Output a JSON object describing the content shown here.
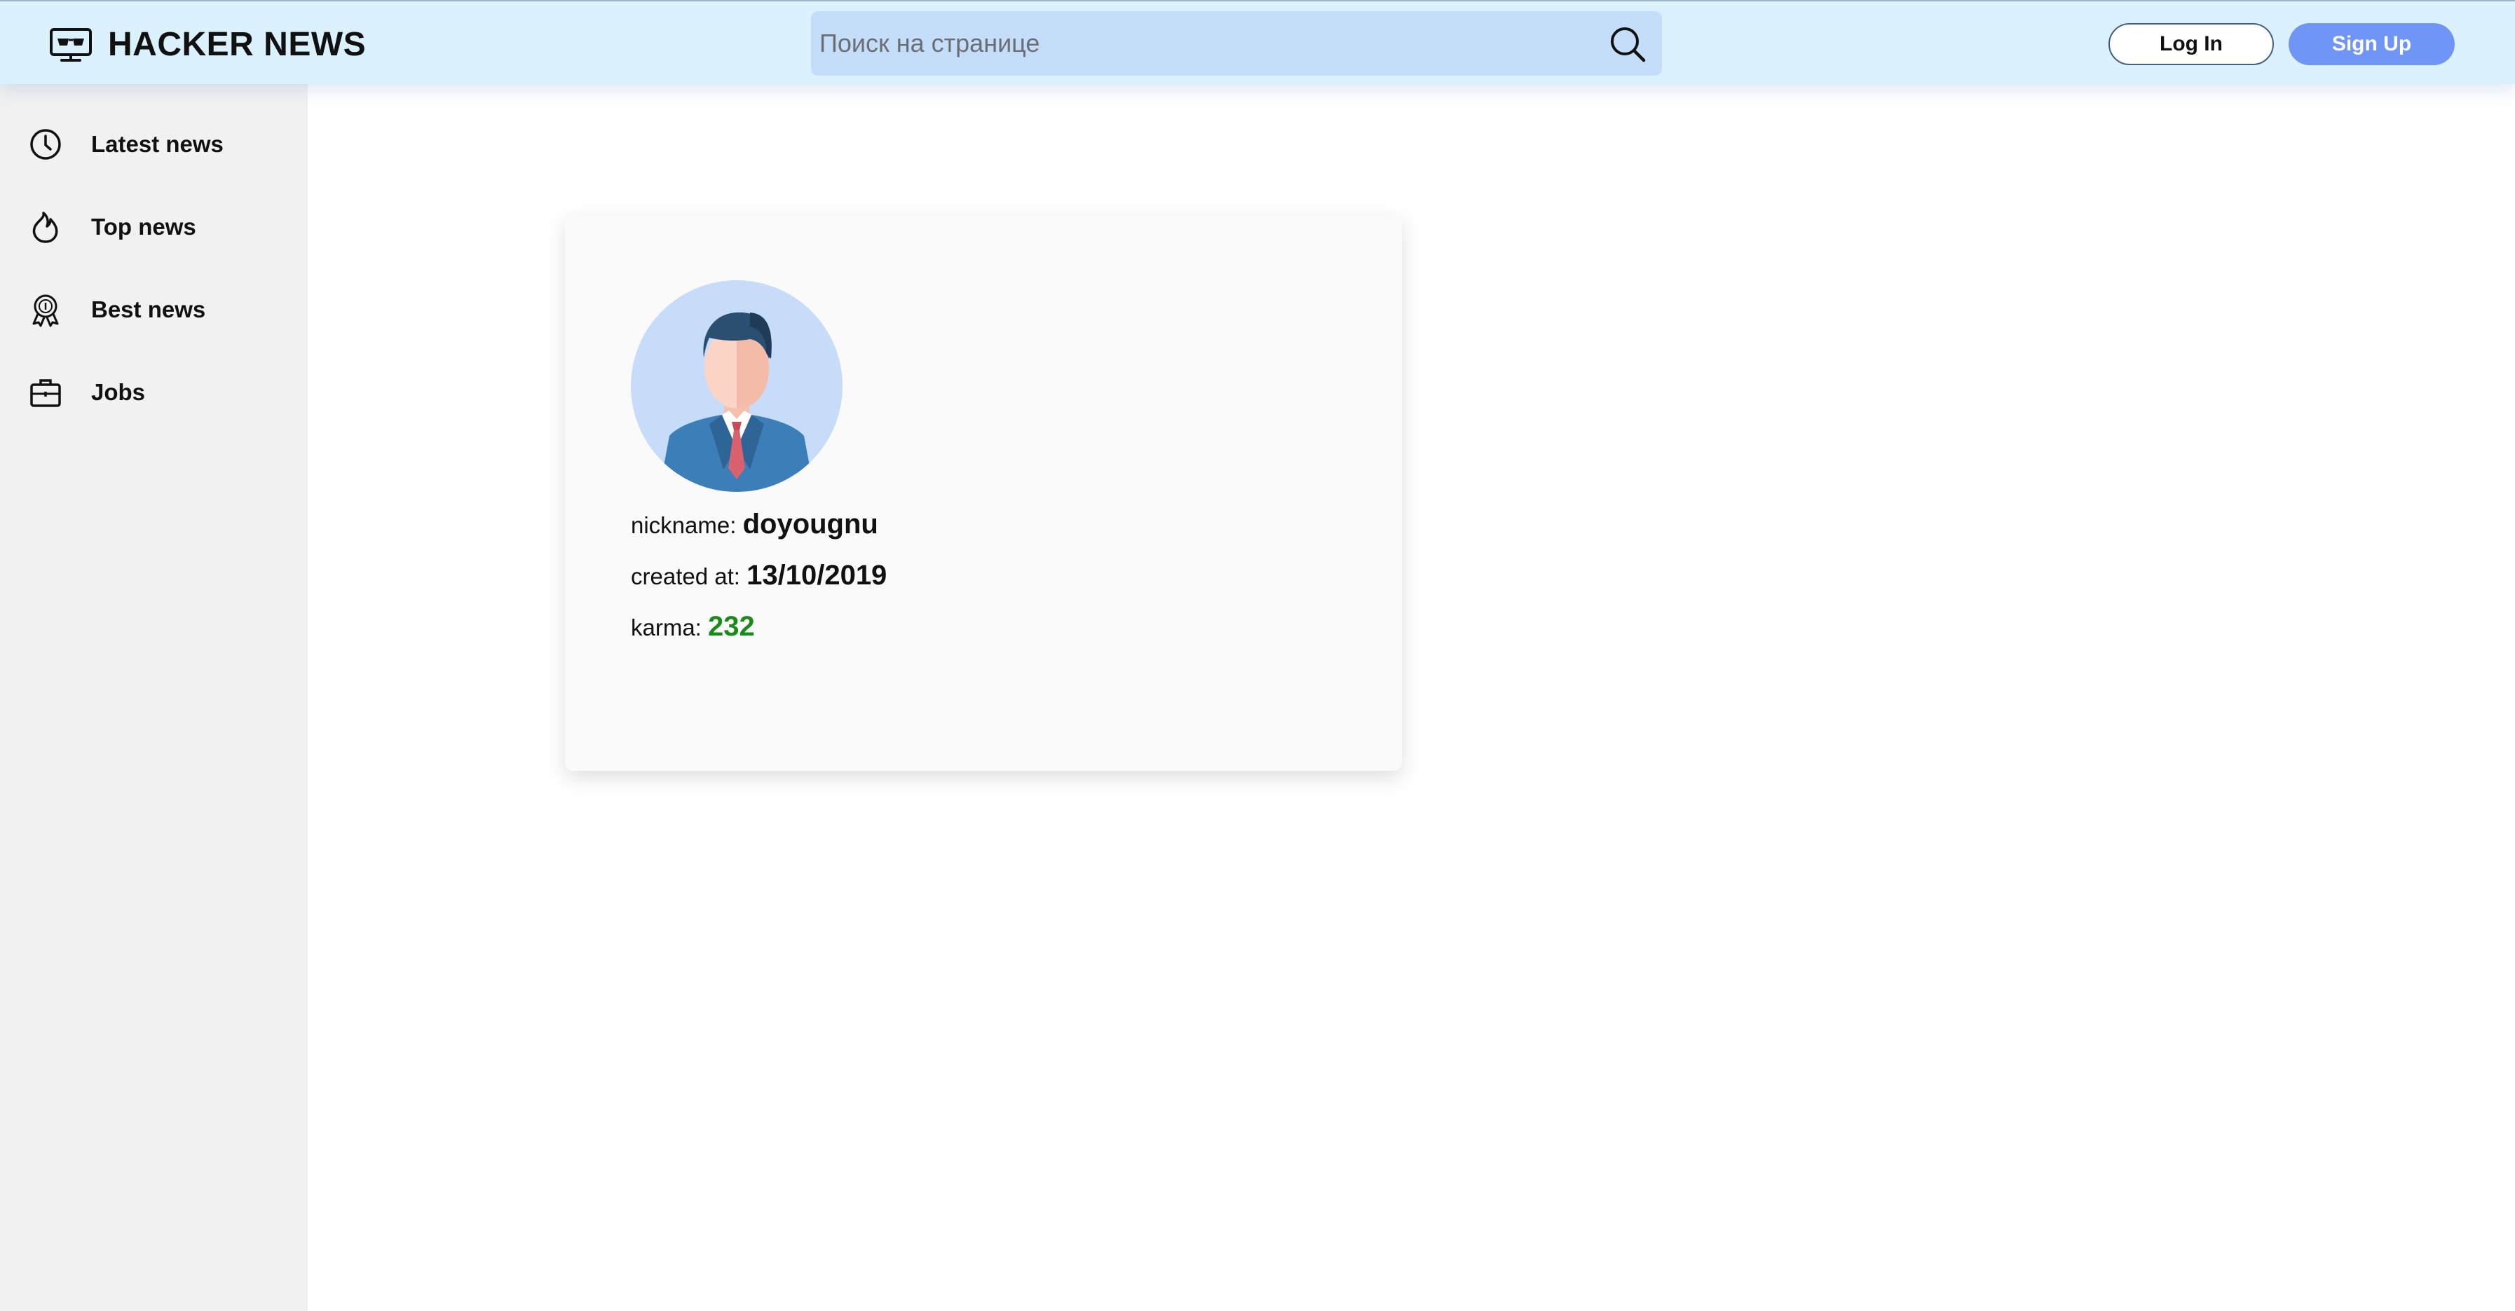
{
  "header": {
    "logo_text": "HACKER NEWS",
    "logo_icon": "monitor-glasses-icon",
    "search_placeholder": "Поиск на странице",
    "login_label": "Log In",
    "signup_label": "Sign Up"
  },
  "sidebar": {
    "items": [
      {
        "label": "Latest news",
        "icon": "clock-icon"
      },
      {
        "label": "Top news",
        "icon": "flame-icon"
      },
      {
        "label": "Best news",
        "icon": "medal-icon"
      },
      {
        "label": "Jobs",
        "icon": "briefcase-icon"
      }
    ]
  },
  "profile": {
    "nickname_label": "nickname:",
    "nickname": "doyougnu",
    "created_label": "created at:",
    "created": "13/10/2019",
    "karma_label": "karma:",
    "karma": "232"
  },
  "colors": {
    "header_bg": "#dbf2fe",
    "search_bg": "#c4defa",
    "signup_bg": "#6f95f6",
    "sidebar_bg": "#f1f1f1",
    "karma": "#1a8a1a"
  }
}
